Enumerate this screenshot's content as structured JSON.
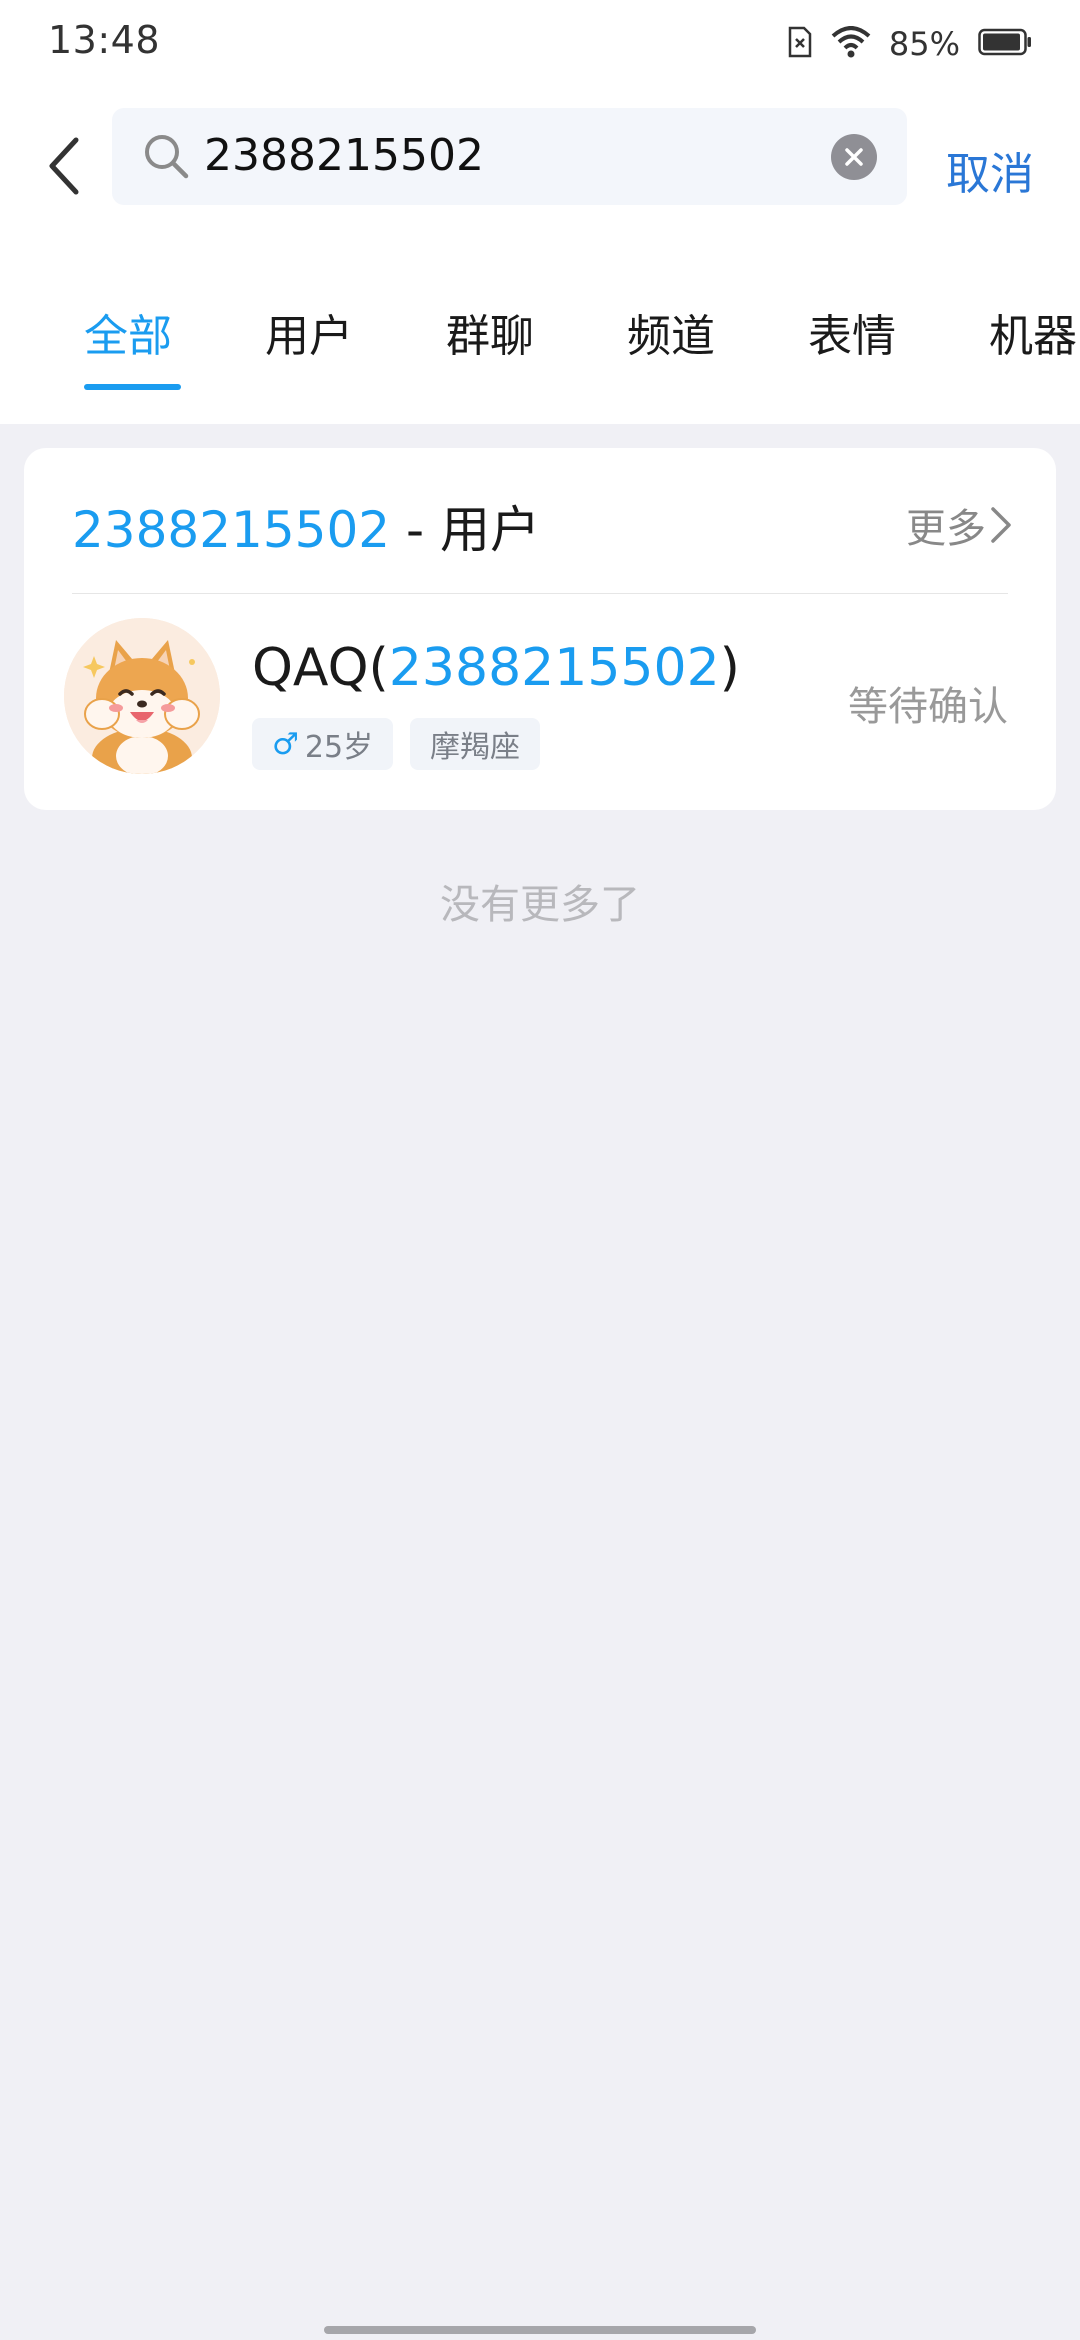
{
  "status_bar": {
    "time": "13:48",
    "battery_text": "85%",
    "icons": [
      "sim-error-icon",
      "wifi-icon",
      "battery-icon"
    ]
  },
  "search": {
    "value": "2388215502",
    "cancel_label": "取消",
    "icons": [
      "back-arrow-icon",
      "search-icon",
      "clear-icon"
    ]
  },
  "tabs": [
    {
      "label": "全部",
      "active": true
    },
    {
      "label": "用户",
      "active": false
    },
    {
      "label": "群聊",
      "active": false
    },
    {
      "label": "频道",
      "active": false
    },
    {
      "label": "表情",
      "active": false
    },
    {
      "label": "机器",
      "active": false
    }
  ],
  "result_section": {
    "query": "2388215502",
    "title_suffix": " - 用户",
    "more_label": "更多",
    "user": {
      "name_prefix": "QAQ(",
      "id": "2388215502",
      "name_suffix": ")",
      "gender_symbol": "♂",
      "age": "25岁",
      "zodiac": "摩羯座",
      "status": "等待确认",
      "avatar": "shiba-dog-avatar"
    }
  },
  "footer_text": "没有更多了",
  "colors": {
    "accent": "#1a9cf0",
    "cancel": "#2a77d6",
    "background": "#f0f0f5"
  }
}
